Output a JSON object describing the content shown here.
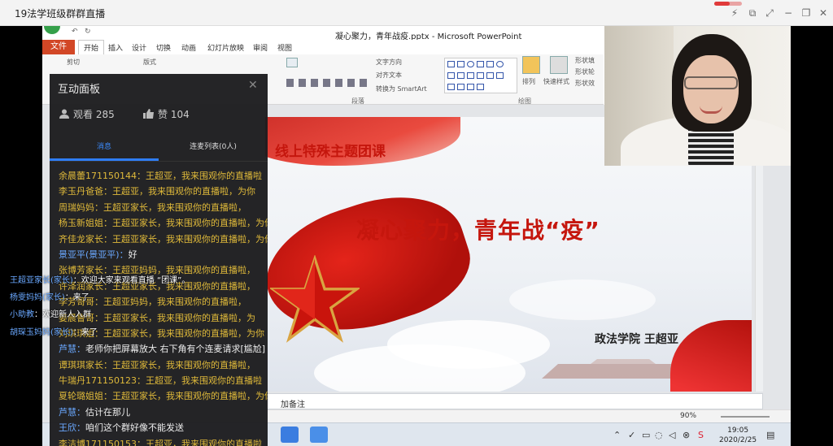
{
  "window": {
    "title": "19法学班级群群直播"
  },
  "ppt": {
    "title": "凝心聚力，青年战疫.pptx - Microsoft PowerPoint",
    "file_tab": "文件",
    "tabs": [
      "开始",
      "插入",
      "设计",
      "切换",
      "动画",
      "幻灯片放映",
      "审阅",
      "视图"
    ],
    "ribbon": {
      "cut": "剪切",
      "layout": "版式",
      "text_direction": "文字方向",
      "align_text": "对齐文本",
      "convert_smartart": "转换为 SmartArt",
      "arrange": "排列",
      "quick_styles": "快速样式",
      "shape_fill": "形状填",
      "shape_outline": "形状轮",
      "shape_effects": "形状效",
      "group_paragraph": "段落",
      "group_drawing": "绘图"
    },
    "slide": {
      "subtitle": "线上特殊主题团课",
      "title": "凝心聚力，青年战“疫”",
      "author": "政法学院  王超亚"
    },
    "notes_placeholder": "加备注",
    "zoom": "90%"
  },
  "taskbar": {
    "time": "19:05",
    "date": "2020/2/25"
  },
  "panel": {
    "title": "互动面板",
    "views_label": "观看 285",
    "likes_label": "赞 104",
    "tab_messages": "消息",
    "tab_mic": "连麦列表(0人)",
    "messages": [
      {
        "name": "余晨蕾171150144：",
        "text": "王超亚，我来围观你的直播啦"
      },
      {
        "name": "李玉丹爸爸：",
        "text": "王超亚，我来围观你的直播啦，为你"
      },
      {
        "name": "周瑞妈妈：",
        "text": "王超亚家长，我来围观你的直播啦，"
      },
      {
        "name": "杨玉新姐姐：",
        "text": "王超亚家长，我来围观你的直播啦，为你"
      },
      {
        "name": "齐佳龙家长：",
        "text": "王超亚家长，我来围观你的直播啦，为你"
      },
      {
        "name": "景亚平(景亚平)：",
        "text": "好",
        "style": "blue"
      },
      {
        "name": "张博芳家长：",
        "text": "王超亚妈妈，我来围观你的直播啦，"
      },
      {
        "name": "许泽润家长：",
        "text": "王超亚家长，我来围观你的直播啦，"
      },
      {
        "name": "李芳哥哥：",
        "text": "王超亚妈妈，我来围观你的直播啦，"
      },
      {
        "name": "姜晨鲁哥：",
        "text": "王超亚家长，我来围观你的直播啦，为"
      },
      {
        "name": "刘琪琪姐：",
        "text": "王超亚家长，我来围观你的直播啦，为你"
      },
      {
        "name": "芦慧：",
        "text": "老师你把屏幕放大 右下角有个连麦请求[尴尬]",
        "style": "blue"
      },
      {
        "name": "谭琪琪家长：",
        "text": "王超亚家长，我来围观你的直播啦，"
      },
      {
        "name": "牛瑞丹171150123：",
        "text": "王超亚，我来围观你的直播啦"
      },
      {
        "name": "夏轮璐姐姐：",
        "text": "王超亚家长，我来围观你的直播啦，为你"
      },
      {
        "name": "芦慧：",
        "text": "估计在那儿",
        "style": "blue"
      },
      {
        "name": "王欣：",
        "text": "咱们这个群好像不能发送",
        "style": "blue"
      },
      {
        "name": "李洁博171150153：",
        "text": "王超亚，我来围观你的直播啦"
      }
    ]
  },
  "danmaku": [
    {
      "name": "王超亚家长(家长)",
      "text": "：欢迎大家来观看直播 “团课”。"
    },
    {
      "name": "杨雯妈妈(家长)",
      "text": "：来了"
    },
    {
      "name": "小助教",
      "text": "：欢迎新人入群"
    },
    {
      "name": "胡琛玉妈妈(家长)",
      "text": "：来了"
    }
  ],
  "colors": {
    "accent": "#2f7df6",
    "ppt_file": "#d24726",
    "slide_red": "#c5160d",
    "message_gold": "#e0ba3a"
  },
  "recording_progress": 0.55
}
